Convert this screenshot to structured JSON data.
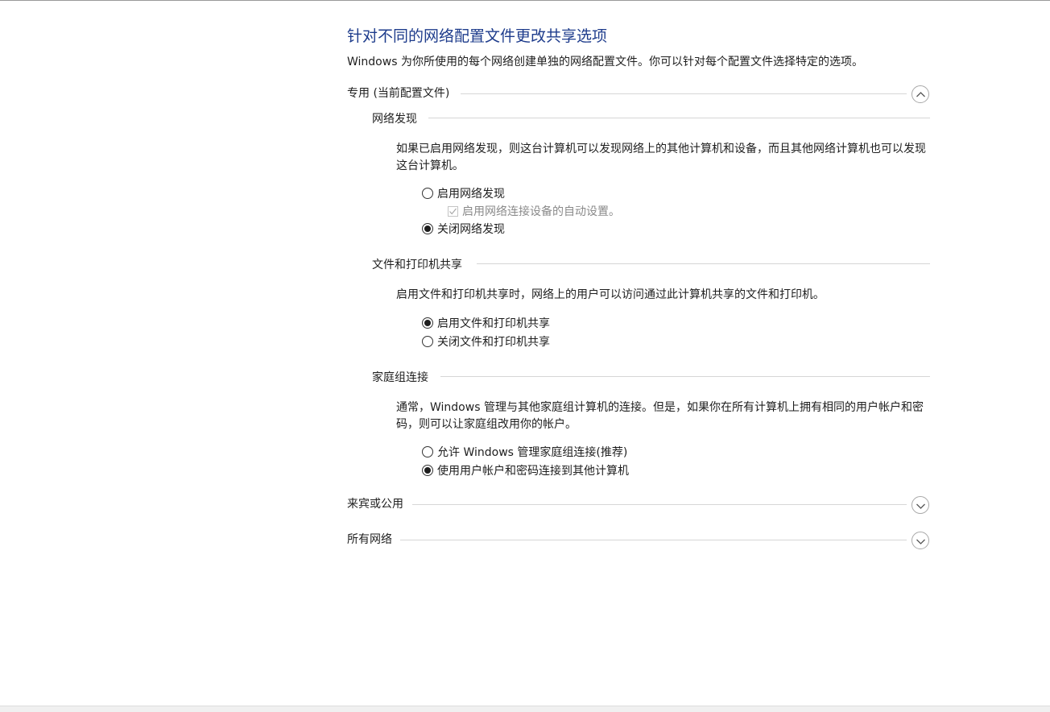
{
  "page": {
    "title": "针对不同的网络配置文件更改共享选项",
    "description": "Windows 为你所使用的每个网络创建单独的网络配置文件。你可以针对每个配置文件选择特定的选项。"
  },
  "private_profile": {
    "label": "专用 (当前配置文件)",
    "expanded": true,
    "network_discovery": {
      "heading": "网络发现",
      "description": "如果已启用网络发现，则这台计算机可以发现网络上的其他计算机和设备，而且其他网络计算机也可以发现这台计算机。",
      "on_label": "启用网络发现",
      "auto_setup_label": "启用网络连接设备的自动设置。",
      "off_label": "关闭网络发现",
      "selected": "off"
    },
    "file_printer_sharing": {
      "heading": "文件和打印机共享",
      "description": "启用文件和打印机共享时，网络上的用户可以访问通过此计算机共享的文件和打印机。",
      "on_label": "启用文件和打印机共享",
      "off_label": "关闭文件和打印机共享",
      "selected": "on"
    },
    "homegroup": {
      "heading": "家庭组连接",
      "description": "通常，Windows 管理与其他家庭组计算机的连接。但是，如果你在所有计算机上拥有相同的用户帐户和密码，则可以让家庭组改用你的帐户。",
      "allow_windows_label": "允许 Windows 管理家庭组连接(推荐)",
      "use_account_label": "使用用户帐户和密码连接到其他计算机",
      "selected": "use_account"
    }
  },
  "guest_public": {
    "label": "来宾或公用",
    "expanded": false
  },
  "all_networks": {
    "label": "所有网络",
    "expanded": false
  },
  "icons": {
    "collapse": "chevron-up-icon",
    "expand": "chevron-down-icon"
  }
}
